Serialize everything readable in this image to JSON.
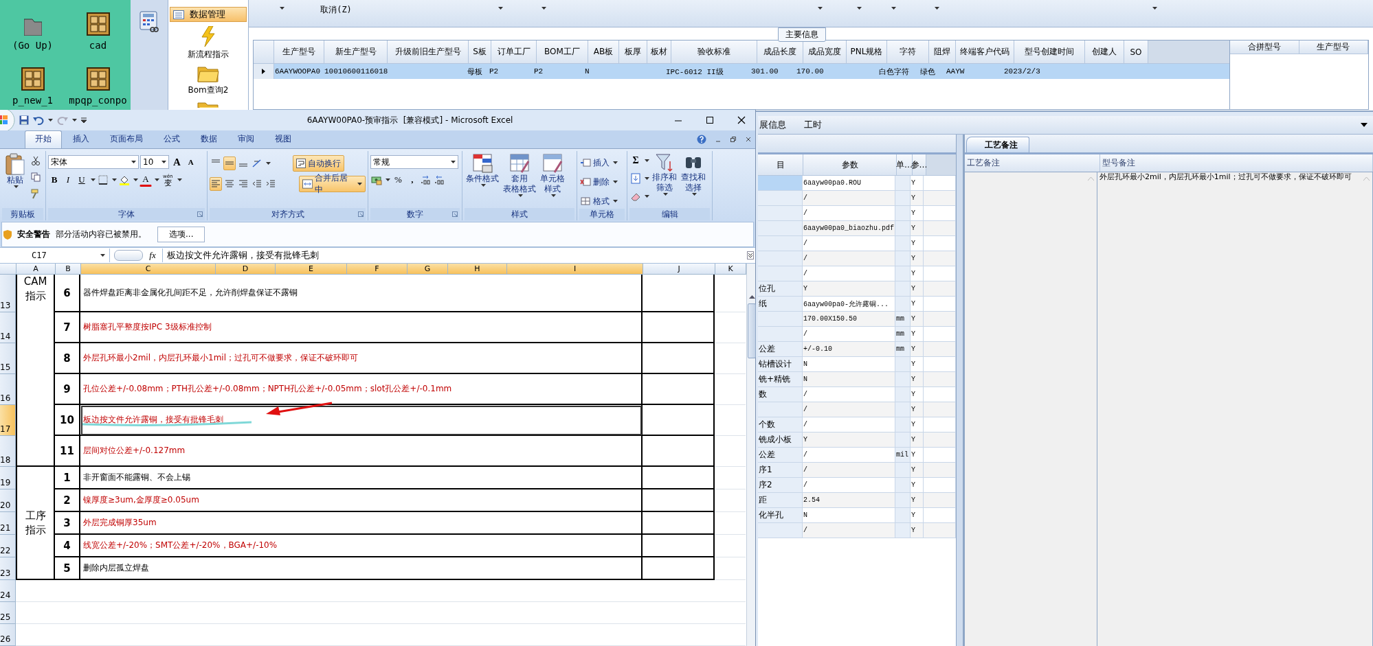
{
  "desktop": {
    "icons": [
      {
        "label": "(Go Up)",
        "kind": "folder"
      },
      {
        "label": "cad",
        "kind": "app"
      },
      {
        "label": "p_new_1",
        "kind": "app"
      },
      {
        "label": "mpqp_conpo",
        "kind": "app"
      }
    ]
  },
  "erp": {
    "nav": [
      {
        "label": "数据管理",
        "kind": "header",
        "selected": true
      },
      {
        "label": "新流程指示",
        "kind": "lightning",
        "selected": false
      },
      {
        "label": "Bom查询2",
        "kind": "folder",
        "selected": false
      },
      {
        "kind": "folder",
        "selected": false
      }
    ],
    "toolbar": {
      "cancel_label": "取消(Z)"
    },
    "main_info": {
      "title": "主要信息",
      "columns": [
        "生产型号",
        "新生产型号",
        "升级前旧生产型号",
        "S板",
        "订单工厂",
        "BOM工厂",
        "AB板",
        "板厚",
        "板材",
        "验收标准",
        "成品长度",
        "成品宽度",
        "PNL规格",
        "字符",
        "阻焊",
        "终端客户代码",
        "型号创建时间",
        "创建人",
        "SO"
      ],
      "rows": [
        {
          "selected": true,
          "cells": [
            "6AAYWOOPA0",
            "10010600116018",
            null,
            "母板",
            "P2",
            "P2",
            "N",
            null,
            null,
            "IPC-6012 II级",
            "301.00",
            "170.00",
            null,
            "白色字符",
            "绿色",
            "AAYW",
            "2023/2/3",
            null,
            null
          ]
        }
      ]
    },
    "merge_list": {
      "columns": [
        "合拼型号",
        "生产型号"
      ]
    },
    "detail_tabs": [
      {
        "label": "展信息"
      },
      {
        "label": "工时"
      }
    ],
    "params": {
      "columns": [
        "目",
        "参数",
        "单…",
        "参…"
      ],
      "rows": [
        {
          "value": "6aayw00pa0.ROU",
          "flag": "Y",
          "selected": true
        },
        {
          "value": "/",
          "flag": "Y",
          "selected": false
        },
        {
          "value": "/",
          "flag": "Y",
          "selected": false
        },
        {
          "value": "6aayw00pa0_biaozhu.pdf",
          "flag": "Y",
          "selected": false
        },
        {
          "value": "/",
          "flag": "Y",
          "selected": false
        },
        {
          "value": "/",
          "flag": "Y",
          "selected": false
        },
        {
          "value": "/",
          "flag": "Y",
          "selected": false
        },
        {
          "item": "位孔",
          "value": "Y",
          "flag": "Y",
          "selected": false
        },
        {
          "item": "纸",
          "value": "6aayw00pa0-允许露铜...",
          "flag": "Y",
          "selected": false
        },
        {
          "value": "170.00X150.50",
          "unit": "mm",
          "flag": "Y",
          "selected": false
        },
        {
          "value": "/",
          "unit": "mm",
          "flag": "Y",
          "selected": false
        },
        {
          "item": "公差",
          "value": "+/-0.10",
          "unit": "mm",
          "flag": "Y",
          "selected": false
        },
        {
          "item": "钻槽设计",
          "value": "N",
          "flag": "Y",
          "selected": false
        },
        {
          "item": "铣+精铣",
          "value": "N",
          "flag": "Y",
          "selected": false
        },
        {
          "item": "数",
          "value": "/",
          "flag": "Y",
          "selected": false
        },
        {
          "value": "/",
          "flag": "Y",
          "selected": false
        },
        {
          "item": "个数",
          "value": "/",
          "flag": "Y",
          "selected": false
        },
        {
          "item": "铣成小板",
          "value": "Y",
          "flag": "Y",
          "selected": false
        },
        {
          "item": "公差",
          "value": "/",
          "unit": "mil",
          "flag": "Y",
          "selected": false
        },
        {
          "item": "序1",
          "value": "/",
          "flag": "Y",
          "selected": false
        },
        {
          "item": "序2",
          "value": "/",
          "flag": "Y",
          "selected": false
        },
        {
          "item": "距",
          "value": "2.54",
          "flag": "Y",
          "selected": false
        },
        {
          "item": "化半孔",
          "value": "N",
          "flag": "Y",
          "selected": false
        },
        {
          "value": "/",
          "flag": "Y",
          "selected": false
        }
      ]
    },
    "notes": {
      "tab": {
        "label": "工艺备注",
        "selected": true
      },
      "columns": [
        "工艺备注",
        "型号备注"
      ],
      "model_note": "外层孔环最小2mil，内层孔环最小1mil；过孔可不做要求，保证不破环即可"
    }
  },
  "excel": {
    "title": "6AAYW00PA0-预审指示  [兼容模式] - Microsoft Excel",
    "tabs": [
      {
        "label": "开始",
        "selected": true
      },
      {
        "label": "插入",
        "selected": false
      },
      {
        "label": "页面布局",
        "selected": false
      },
      {
        "label": "公式",
        "selected": false
      },
      {
        "label": "数据",
        "selected": false
      },
      {
        "label": "审阅",
        "selected": false
      },
      {
        "label": "视图",
        "selected": false
      }
    ],
    "ribbon": [
      {
        "label": "剪贴板",
        "kind": "clipboard",
        "paste": "粘贴"
      },
      {
        "label": "字体",
        "kind": "font",
        "font": "宋体",
        "size": "10",
        "grow": "A",
        "shrink": "A",
        "bold": "B",
        "italic": "I",
        "underline": "U",
        "font_color": "A",
        "phonetic_top": "wén",
        "phonetic_bottom": "变"
      },
      {
        "label": "对齐方式",
        "kind": "alignment",
        "vertical": [
          {
            "selected": false
          },
          {
            "selected": true
          },
          {
            "selected": false
          }
        ],
        "horizontal": [
          {
            "selected": true
          },
          {
            "selected": false
          },
          {
            "selected": false
          }
        ],
        "wrap": {
          "label": "自动换行",
          "on": true
        },
        "merge": {
          "label": "合并后居中",
          "on": true
        }
      },
      {
        "label": "数字",
        "kind": "number",
        "format": "常规",
        "percent": "%",
        "comma": ","
      },
      {
        "label": "样式",
        "kind": "styles",
        "buttons": [
          [
            "条件格式"
          ],
          [
            "套用",
            "表格格式"
          ],
          [
            "单元格",
            "样式"
          ]
        ]
      },
      {
        "label": "单元格",
        "kind": "cells",
        "buttons": [
          "插入",
          "删除",
          "格式"
        ]
      },
      {
        "label": "编辑",
        "kind": "editing",
        "sum": "Σ",
        "buttons": [
          [
            "排序和",
            "筛选"
          ],
          [
            "查找和",
            "选择"
          ]
        ]
      }
    ],
    "security": {
      "title": "安全警告",
      "message": "部分活动内容已被禁用。",
      "button": "选项..."
    },
    "formula": {
      "cell": "C17",
      "fx": "fx",
      "content": "板边按文件允许露铜，接受有批锋毛刺"
    },
    "columns": [
      {
        "label": "A",
        "selected": false
      },
      {
        "label": "B",
        "selected": false
      },
      {
        "label": "C",
        "selected": true
      },
      {
        "label": "D",
        "selected": true
      },
      {
        "label": "E",
        "selected": true
      },
      {
        "label": "F",
        "selected": true
      },
      {
        "label": "G",
        "selected": true
      },
      {
        "label": "H",
        "selected": true
      },
      {
        "label": "I",
        "selected": true
      },
      {
        "label": "J",
        "selected": false
      },
      {
        "label": "K",
        "selected": false
      }
    ],
    "sections": [
      {
        "label": [
          "CAM",
          "指示"
        ],
        "rows": [
          {
            "number": "13",
            "index": "6",
            "text": "器件焊盘距离非金属化孔间距不足，允许削焊盘保证不露铜",
            "highlighted": false,
            "selected": false
          },
          {
            "number": "14",
            "index": "7",
            "text": "树脂塞孔平整度按IPC 3级标准控制",
            "highlighted": true,
            "selected": false
          },
          {
            "number": "15",
            "index": "8",
            "text": "外层孔环最小2mil，内层孔环最小1mil；过孔可不做要求，保证不破环即可",
            "highlighted": true,
            "selected": false
          },
          {
            "number": "16",
            "index": "9",
            "text": "孔位公差+/-0.08mm；PTH孔公差+/-0.08mm；NPTH孔公差+/-0.05mm；slot孔公差+/-0.1mm",
            "highlighted": true,
            "selected": false
          },
          {
            "number": "17",
            "index": "10",
            "text": "板边按文件允许露铜，接受有批锋毛刺",
            "highlighted": true,
            "selected": true
          },
          {
            "number": "18",
            "index": "11",
            "text": "层间对位公差+/-0.127mm",
            "highlighted": true,
            "selected": false
          }
        ]
      },
      {
        "label": [
          "工序",
          "指示"
        ],
        "rows": [
          {
            "number": "19",
            "index": "1",
            "text": "非开窗面不能露铜、不会上锡",
            "highlighted": false,
            "selected": false
          },
          {
            "number": "20",
            "index": "2",
            "text": "镍厚度≥3um,金厚度≥0.05um",
            "highlighted": true,
            "selected": false
          },
          {
            "number": "21",
            "index": "3",
            "text": "外层完成铜厚35um",
            "highlighted": true,
            "selected": false
          },
          {
            "number": "22",
            "index": "4",
            "text": "线宽公差+/-20%；SMT公差+/-20%，BGA+/-10%",
            "highlighted": true,
            "selected": false
          },
          {
            "number": "23",
            "index": "5",
            "text": "删除内层孤立焊盘",
            "highlighted": false,
            "selected": false
          }
        ]
      }
    ],
    "empty_rows": [
      "24",
      "25",
      "26"
    ]
  }
}
